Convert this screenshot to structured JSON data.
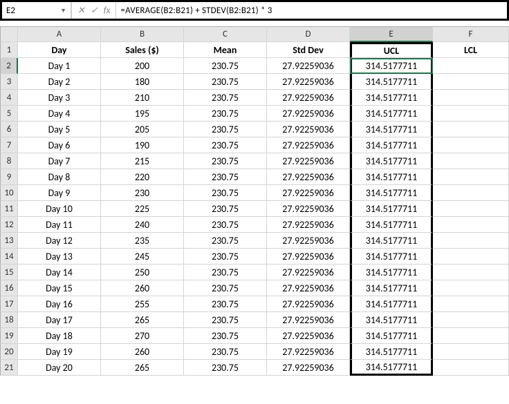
{
  "name_box": "E2",
  "fx_glyphs": {
    "cancel": "✕",
    "check": "✓",
    "fx": "fx"
  },
  "formula": "=AVERAGE(B2:B21) + STDEV(B2:B21) * 3",
  "columns": [
    "A",
    "B",
    "C",
    "D",
    "E",
    "F"
  ],
  "headers": [
    "Day",
    "Sales ($)",
    "Mean",
    "Std Dev",
    "UCL",
    "LCL"
  ],
  "rows": [
    {
      "n": "2",
      "day": "Day 1",
      "sales": "200",
      "mean": "230.75",
      "std": "27.92259036",
      "ucl": "314.5177711",
      "lcl": ""
    },
    {
      "n": "3",
      "day": "Day 2",
      "sales": "180",
      "mean": "230.75",
      "std": "27.92259036",
      "ucl": "314.5177711",
      "lcl": ""
    },
    {
      "n": "4",
      "day": "Day 3",
      "sales": "210",
      "mean": "230.75",
      "std": "27.92259036",
      "ucl": "314.5177711",
      "lcl": ""
    },
    {
      "n": "5",
      "day": "Day 4",
      "sales": "195",
      "mean": "230.75",
      "std": "27.92259036",
      "ucl": "314.5177711",
      "lcl": ""
    },
    {
      "n": "6",
      "day": "Day 5",
      "sales": "205",
      "mean": "230.75",
      "std": "27.92259036",
      "ucl": "314.5177711",
      "lcl": ""
    },
    {
      "n": "7",
      "day": "Day 6",
      "sales": "190",
      "mean": "230.75",
      "std": "27.92259036",
      "ucl": "314.5177711",
      "lcl": ""
    },
    {
      "n": "8",
      "day": "Day 7",
      "sales": "215",
      "mean": "230.75",
      "std": "27.92259036",
      "ucl": "314.5177711",
      "lcl": ""
    },
    {
      "n": "9",
      "day": "Day 8",
      "sales": "220",
      "mean": "230.75",
      "std": "27.92259036",
      "ucl": "314.5177711",
      "lcl": ""
    },
    {
      "n": "10",
      "day": "Day 9",
      "sales": "230",
      "mean": "230.75",
      "std": "27.92259036",
      "ucl": "314.5177711",
      "lcl": ""
    },
    {
      "n": "11",
      "day": "Day 10",
      "sales": "225",
      "mean": "230.75",
      "std": "27.92259036",
      "ucl": "314.5177711",
      "lcl": ""
    },
    {
      "n": "12",
      "day": "Day 11",
      "sales": "240",
      "mean": "230.75",
      "std": "27.92259036",
      "ucl": "314.5177711",
      "lcl": ""
    },
    {
      "n": "13",
      "day": "Day 12",
      "sales": "235",
      "mean": "230.75",
      "std": "27.92259036",
      "ucl": "314.5177711",
      "lcl": ""
    },
    {
      "n": "14",
      "day": "Day 13",
      "sales": "245",
      "mean": "230.75",
      "std": "27.92259036",
      "ucl": "314.5177711",
      "lcl": ""
    },
    {
      "n": "15",
      "day": "Day 14",
      "sales": "250",
      "mean": "230.75",
      "std": "27.92259036",
      "ucl": "314.5177711",
      "lcl": ""
    },
    {
      "n": "16",
      "day": "Day 15",
      "sales": "260",
      "mean": "230.75",
      "std": "27.92259036",
      "ucl": "314.5177711",
      "lcl": ""
    },
    {
      "n": "17",
      "day": "Day 16",
      "sales": "255",
      "mean": "230.75",
      "std": "27.92259036",
      "ucl": "314.5177711",
      "lcl": ""
    },
    {
      "n": "18",
      "day": "Day 17",
      "sales": "265",
      "mean": "230.75",
      "std": "27.92259036",
      "ucl": "314.5177711",
      "lcl": ""
    },
    {
      "n": "19",
      "day": "Day 18",
      "sales": "270",
      "mean": "230.75",
      "std": "27.92259036",
      "ucl": "314.5177711",
      "lcl": ""
    },
    {
      "n": "20",
      "day": "Day 19",
      "sales": "260",
      "mean": "230.75",
      "std": "27.92259036",
      "ucl": "314.5177711",
      "lcl": ""
    },
    {
      "n": "21",
      "day": "Day 20",
      "sales": "265",
      "mean": "230.75",
      "std": "27.92259036",
      "ucl": "314.5177711",
      "lcl": ""
    }
  ]
}
